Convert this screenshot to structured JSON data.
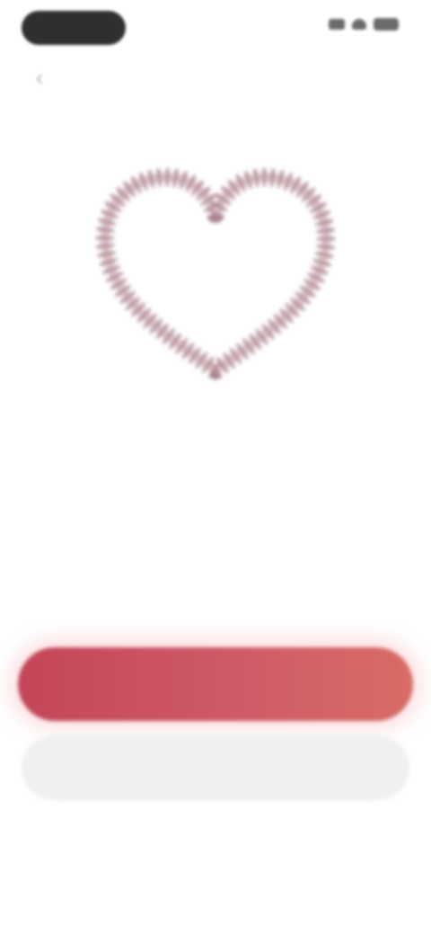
{
  "status_bar": {
    "time": "",
    "icons": [
      "signal-icon",
      "wifi-icon",
      "battery-icon"
    ]
  },
  "nav": {
    "title": "",
    "back_icon": "chevron-left-icon"
  },
  "illustration": {
    "icon": "heart-icon",
    "color": "#9a6a76"
  },
  "content": {
    "headline": "",
    "description_line1": "",
    "description_line2": ""
  },
  "actions": {
    "primary_label": "",
    "secondary_label": ""
  },
  "colors": {
    "primary_gradient_start": "#c34658",
    "primary_gradient_end": "#d86c66",
    "secondary_background": "#f0f0f0"
  }
}
